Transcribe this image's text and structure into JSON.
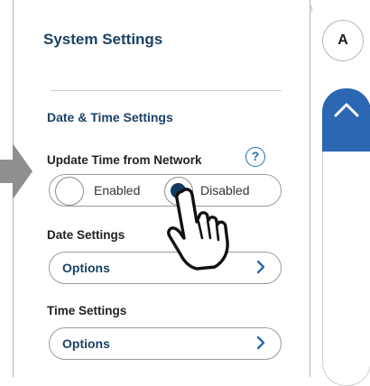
{
  "header": {
    "title": "System Settings",
    "avatar_initial": "A"
  },
  "section": {
    "title": "Date & Time Settings"
  },
  "network_time": {
    "label": "Update Time from Network",
    "help_glyph": "?",
    "options": [
      "Enabled",
      "Disabled"
    ],
    "selected": "Disabled"
  },
  "date_settings": {
    "label": "Date Settings",
    "button_label": "Options"
  },
  "time_settings": {
    "label": "Time Settings",
    "button_label": "Options"
  },
  "colors": {
    "accent": "#2b67b3",
    "title": "#1c4166",
    "selected_radio": "#123a5e",
    "arrow": "#8f8f8f"
  },
  "icons": {
    "help": "question-circle-icon",
    "chevron": "chevron-right-icon",
    "scroll_up": "chevron-up-icon",
    "pointer": "hand-pointer-icon",
    "indicator_arrow": "right-arrow-icon"
  }
}
